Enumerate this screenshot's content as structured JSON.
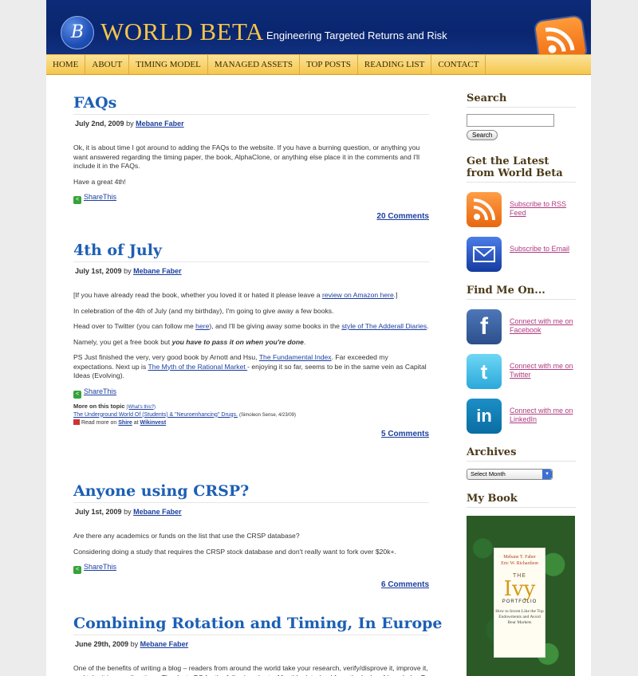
{
  "header": {
    "logo_letter": "B",
    "site_title": "WORLD BETA",
    "tagline": "Engineering Targeted Returns and Risk",
    "rss_icon": "rss-icon"
  },
  "nav": {
    "items": [
      "HOME",
      "ABOUT",
      "TIMING MODEL",
      "MANAGED ASSETS",
      "TOP POSTS",
      "READING LIST",
      "CONTACT"
    ]
  },
  "posts": [
    {
      "title": "FAQs",
      "date": "July 2nd, 2009",
      "by": "by",
      "author": "Mebane Faber",
      "p1": "Ok, it is about time I got around to adding the FAQs to the website.  If you have a burning question, or anything you want answered regarding the timing paper, the book, AlphaClone, or anything else place it in the comments and I'll include it in the FAQs.",
      "p2": "Have a great 4th!",
      "share": "ShareThis",
      "comments": "20 Comments"
    },
    {
      "title": "4th of July",
      "date": "July 1st, 2009",
      "by": "by",
      "author": "Mebane Faber",
      "p1_pre": "[If you have already read the book, whether you loved it or hated it please leave a ",
      "p1_link": "review on Amazon here",
      "p1_post": ".]",
      "p2": "In celebration of the 4th of July (and my birthday), I'm going to give away a few books.",
      "p3_pre": "Head over to Twitter (you can follow me ",
      "p3_link1": "here",
      "p3_mid": "), and I'll be giving away some books in the ",
      "p3_link2": "style of The Adderall Diaries",
      "p3_post": ".",
      "p4_pre": "Namely, you get a free book but ",
      "p4_bold": "you have to pass it on when you're done",
      "p4_post": ".",
      "p5_pre": "PS Just finished the very, very good book by Arnott and Hsu, ",
      "p5_link1": "The Fundamental Index",
      "p5_mid": ".  Far exceeded my expectations.  Next up is ",
      "p5_link2": "The Myth of the Rational Market ",
      "p5_post": "- enjoying it so far, seems to be in the same vein as Capital Ideas (Evolving).",
      "share": "ShareThis",
      "topic_label": "More on this topic",
      "topic_whats": "(What's this?)",
      "topic_link": "The Underground World Of (Students) & \"Neuroenhancing\" Drugs.",
      "topic_source": "(Simoleon Sense, 4/23/09)",
      "topic_read": "Read more on",
      "topic_shire": "Shire",
      "topic_at": "at",
      "topic_wiki": "Wikinvest",
      "comments": "5 Comments"
    },
    {
      "title": "Anyone using CRSP?",
      "date": "July 1st, 2009",
      "by": "by",
      "author": "Mebane Faber",
      "p1": "Are there any academics or funds on the list that use the CRSP database?",
      "p2": "Considering doing a study that requires the CRSP stock database and don't really want to fork over $20k+.",
      "share": "ShareThis",
      "comments": "6 Comments"
    },
    {
      "title": "Combining Rotation and Timing, In Europe",
      "date": "June 29th, 2009",
      "by": "by",
      "author": "Mebane Faber",
      "p1": "One of the benefits of writing a blog – readers from around the world take your research, verify/disprove it, improve it, and take it in new directions.  Thanks to PC for the following charts.  Monthly data (and from the looks of it excludes T-bill yield when sitting in cash)."
    }
  ],
  "sidebar": {
    "search_title": "Search",
    "search_button": "Search",
    "latest_title": "Get the Latest from World Beta",
    "rss_link": "Subscribe to RSS Feed",
    "email_link": "Subscribe to Email",
    "find_title": "Find Me On...",
    "facebook_link": "Connect with me on Facebook",
    "twitter_link": "Connect with me on Twitter",
    "linkedin_link": "Connect with me on LinkedIn",
    "archives_title": "Archives",
    "archives_select": "Select Month",
    "book_title": "My Book",
    "book": {
      "author1": "Mebane T. Faber",
      "author2": "Eric W. Richardson",
      "the": "THE",
      "ivy": "Ivy",
      "portfolio": "PORTFOLIO",
      "subtitle": "How to Invest Like the Top Endowments and Avoid Bear Markets"
    }
  },
  "colors": {
    "header_bg": "#0a2670",
    "title_gold": "#f5c54a",
    "nav_bg": "#f5c64c",
    "link_blue": "#1c3fa0",
    "post_title": "#1c5fb5"
  }
}
